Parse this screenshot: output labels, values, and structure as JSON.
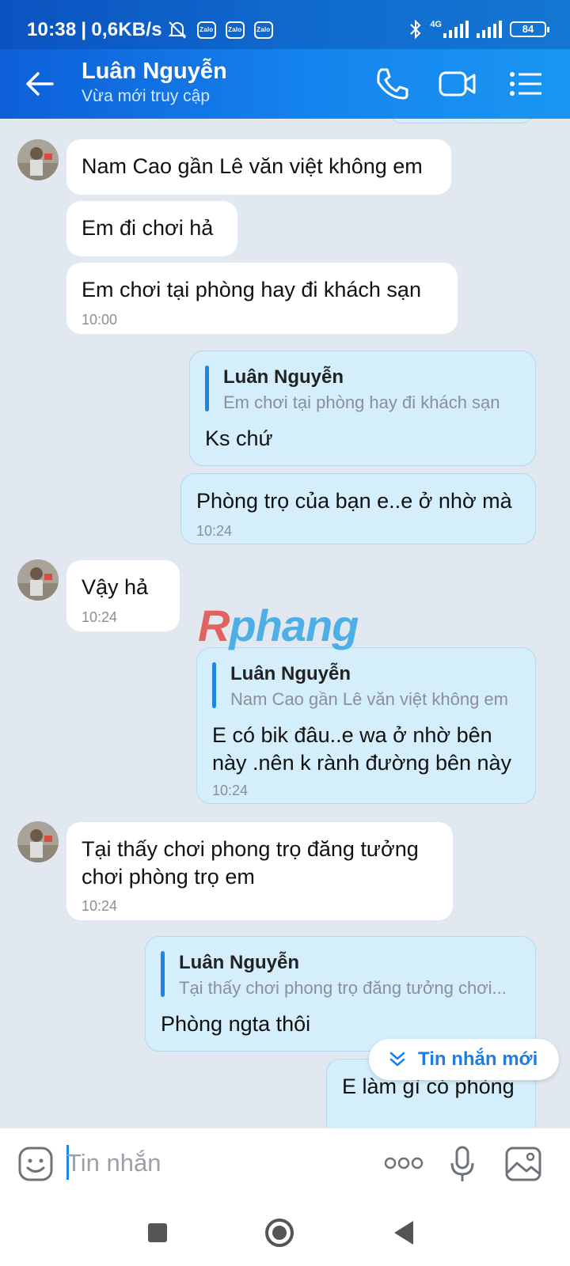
{
  "status_bar": {
    "time": "10:38",
    "speed": "0,6KB/s",
    "zalo_badge": "Zalo",
    "network": "4G",
    "battery": "84"
  },
  "header": {
    "contact_name": "Luân Nguyễn",
    "presence": "Vừa mới truy cập"
  },
  "messages": [
    {
      "direction": "in",
      "text": "Nam Cao gần Lê văn việt không em"
    },
    {
      "direction": "in",
      "text": "Em đi chơi hả"
    },
    {
      "direction": "in",
      "text": "Em chơi tại phòng hay đi khách sạn",
      "time": "10:00"
    },
    {
      "direction": "out",
      "quote_name": "Luân Nguyễn",
      "quote_text": "Em chơi tại phòng hay đi khách sạn",
      "text": "Ks chứ"
    },
    {
      "direction": "out",
      "text": "Phòng trọ của bạn e..e ở nhờ mà",
      "time": "10:24"
    },
    {
      "direction": "in",
      "text": "Vậy hả",
      "time": "10:24"
    },
    {
      "direction": "out",
      "quote_name": "Luân Nguyễn",
      "quote_text": "Nam Cao gần Lê văn việt không em",
      "text_lines": [
        "E có bik đâu..e wa ở nhờ bên",
        "này .nên k rành đường bên này"
      ],
      "time": "10:24"
    },
    {
      "direction": "in",
      "text_lines": [
        "Tại thấy chơi phong trọ đăng tưởng",
        "chơi phòng trọ em"
      ],
      "time": "10:24"
    },
    {
      "direction": "out",
      "quote_name": "Luân Nguyễn",
      "quote_text": "Tại thấy chơi phong trọ đăng tưởng chơi...",
      "text": "Phòng ngta thôi"
    },
    {
      "direction": "out",
      "text": "E làm gì có phòng"
    }
  ],
  "watermark": {
    "part1": "R",
    "part2": "phang"
  },
  "new_message_button": "Tin nhắn mới",
  "composer": {
    "placeholder": "Tin nhắn"
  },
  "colors": {
    "header_start": "#0d5fd8",
    "header_end": "#1a96f2",
    "outgoing_bubble": "#d4eefc",
    "accent": "#1f84e6",
    "chat_bg": "#e2e8f0"
  },
  "icons": [
    "back-arrow-icon",
    "phone-icon",
    "video-call-icon",
    "menu-list-icon",
    "emoji-icon",
    "more-dots-icon",
    "microphone-icon",
    "image-gallery-icon",
    "chevron-double-down-icon",
    "home-nav-icon",
    "recents-nav-icon",
    "back-nav-icon"
  ]
}
